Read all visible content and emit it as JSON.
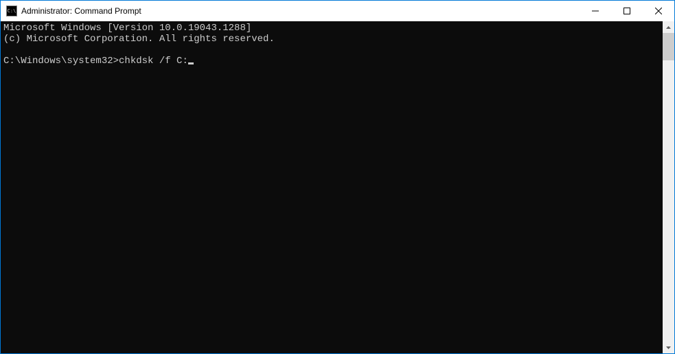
{
  "titlebar": {
    "icon_label": "C:\\",
    "title": "Administrator: Command Prompt"
  },
  "terminal": {
    "line1": "Microsoft Windows [Version 10.0.19043.1288]",
    "line2": "(c) Microsoft Corporation. All rights reserved.",
    "blank": "",
    "prompt": "C:\\Windows\\system32>",
    "command": "chkdsk /f C:"
  }
}
